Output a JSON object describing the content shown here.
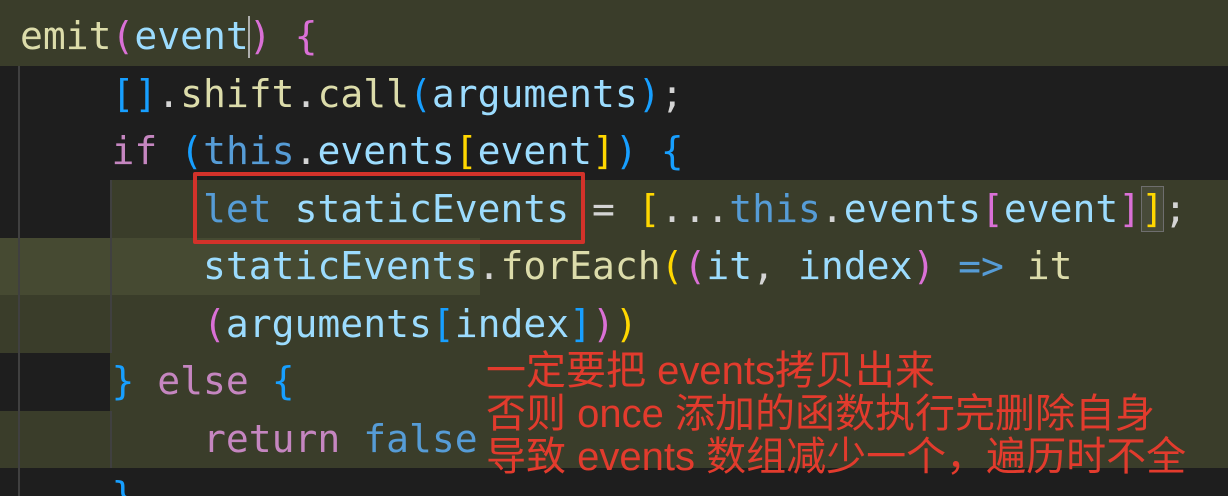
{
  "editor": {
    "theme": {
      "background": "#1e1e1e",
      "line_highlight": "#3a3d2a",
      "word_highlight": "#464a32",
      "indent_guide": "#404040",
      "cursor": "#aeafad",
      "default_text": "#d4d4d4"
    },
    "lines": [
      {
        "tokens": [
          {
            "text": "emit",
            "color": "#dcdcaa"
          },
          {
            "text": "(",
            "color": "#da70d6"
          },
          {
            "text": "event",
            "color": "#9cdcfe"
          },
          {
            "text": ")",
            "color": "#da70d6"
          },
          {
            "text": " ",
            "color": "#d4d4d4"
          },
          {
            "text": "{",
            "color": "#da70d6"
          }
        ]
      },
      {
        "tokens": [
          {
            "text": "    ",
            "color": "#d4d4d4"
          },
          {
            "text": "[]",
            "color": "#179fff"
          },
          {
            "text": ".",
            "color": "#d4d4d4"
          },
          {
            "text": "shift",
            "color": "#dcdcaa"
          },
          {
            "text": ".",
            "color": "#d4d4d4"
          },
          {
            "text": "call",
            "color": "#dcdcaa"
          },
          {
            "text": "(",
            "color": "#179fff"
          },
          {
            "text": "arguments",
            "color": "#9cdcfe"
          },
          {
            "text": ")",
            "color": "#179fff"
          },
          {
            "text": ";",
            "color": "#d4d4d4"
          }
        ]
      },
      {
        "tokens": [
          {
            "text": "    ",
            "color": "#d4d4d4"
          },
          {
            "text": "if",
            "color": "#c586c0"
          },
          {
            "text": " ",
            "color": "#d4d4d4"
          },
          {
            "text": "(",
            "color": "#179fff"
          },
          {
            "text": "this",
            "color": "#569cd6"
          },
          {
            "text": ".",
            "color": "#d4d4d4"
          },
          {
            "text": "events",
            "color": "#9cdcfe"
          },
          {
            "text": "[",
            "color": "#ffd700"
          },
          {
            "text": "event",
            "color": "#9cdcfe"
          },
          {
            "text": "]",
            "color": "#ffd700"
          },
          {
            "text": ")",
            "color": "#179fff"
          },
          {
            "text": " ",
            "color": "#d4d4d4"
          },
          {
            "text": "{",
            "color": "#179fff"
          }
        ]
      },
      {
        "tokens": [
          {
            "text": "        ",
            "color": "#d4d4d4"
          },
          {
            "text": "let",
            "color": "#569cd6"
          },
          {
            "text": " ",
            "color": "#d4d4d4"
          },
          {
            "text": "staticEvents",
            "color": "#9cdcfe"
          },
          {
            "text": " = ",
            "color": "#d4d4d4"
          },
          {
            "text": "[",
            "color": "#ffd700"
          },
          {
            "text": "...",
            "color": "#d4d4d4"
          },
          {
            "text": "this",
            "color": "#569cd6"
          },
          {
            "text": ".",
            "color": "#d4d4d4"
          },
          {
            "text": "events",
            "color": "#9cdcfe"
          },
          {
            "text": "[",
            "color": "#da70d6"
          },
          {
            "text": "event",
            "color": "#9cdcfe"
          },
          {
            "text": "]",
            "color": "#da70d6"
          },
          {
            "text": "]",
            "color": "#ffd700"
          },
          {
            "text": ";",
            "color": "#d4d4d4"
          }
        ]
      },
      {
        "tokens": [
          {
            "text": "        ",
            "color": "#d4d4d4"
          },
          {
            "text": "staticEvents",
            "color": "#9cdcfe"
          },
          {
            "text": ".",
            "color": "#d4d4d4"
          },
          {
            "text": "forEach",
            "color": "#dcdcaa"
          },
          {
            "text": "(",
            "color": "#ffd700"
          },
          {
            "text": "(",
            "color": "#da70d6"
          },
          {
            "text": "it",
            "color": "#9cdcfe"
          },
          {
            "text": ", ",
            "color": "#d4d4d4"
          },
          {
            "text": "index",
            "color": "#9cdcfe"
          },
          {
            "text": ")",
            "color": "#da70d6"
          },
          {
            "text": " ",
            "color": "#d4d4d4"
          },
          {
            "text": "=>",
            "color": "#569cd6"
          },
          {
            "text": " ",
            "color": "#d4d4d4"
          },
          {
            "text": "it",
            "color": "#dcdcaa"
          }
        ]
      },
      {
        "tokens": [
          {
            "text": "        ",
            "color": "#d4d4d4"
          },
          {
            "text": "(",
            "color": "#da70d6"
          },
          {
            "text": "arguments",
            "color": "#9cdcfe"
          },
          {
            "text": "[",
            "color": "#179fff"
          },
          {
            "text": "index",
            "color": "#9cdcfe"
          },
          {
            "text": "]",
            "color": "#179fff"
          },
          {
            "text": ")",
            "color": "#da70d6"
          },
          {
            "text": ")",
            "color": "#ffd700"
          }
        ]
      },
      {
        "tokens": [
          {
            "text": "    ",
            "color": "#d4d4d4"
          },
          {
            "text": "}",
            "color": "#179fff"
          },
          {
            "text": " ",
            "color": "#d4d4d4"
          },
          {
            "text": "else",
            "color": "#c586c0"
          },
          {
            "text": " ",
            "color": "#d4d4d4"
          },
          {
            "text": "{",
            "color": "#179fff"
          }
        ]
      },
      {
        "tokens": [
          {
            "text": "        ",
            "color": "#d4d4d4"
          },
          {
            "text": "return",
            "color": "#c586c0"
          },
          {
            "text": " ",
            "color": "#d4d4d4"
          },
          {
            "text": "false",
            "color": "#569cd6"
          }
        ]
      },
      {
        "tokens": [
          {
            "text": "    ",
            "color": "#d4d4d4"
          },
          {
            "text": "}",
            "color": "#179fff"
          }
        ]
      }
    ]
  },
  "annotation": {
    "box_color": "#d3322a",
    "text_color": "#e23b2d",
    "lines": [
      "一定要把 events拷贝出来",
      "否则 once 添加的函数执行完删除自身",
      "导致 events 数组减少一个，遍历时不全"
    ]
  }
}
